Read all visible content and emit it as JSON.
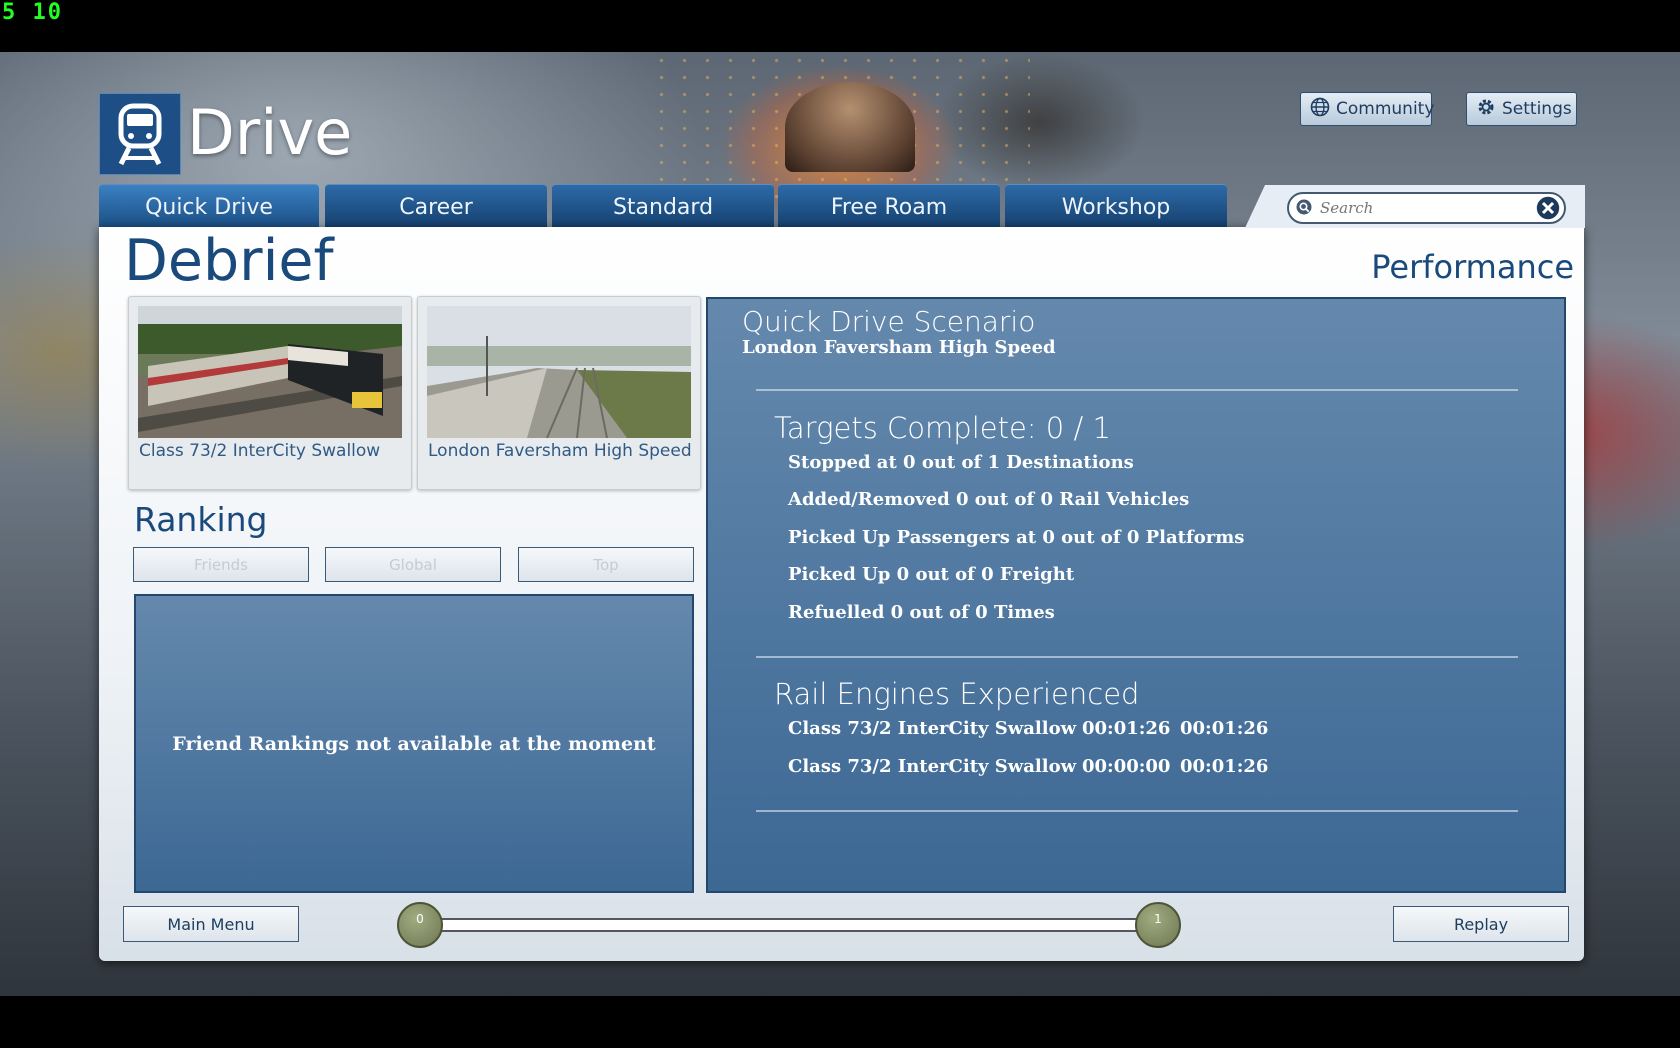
{
  "fps_counter": "5 10",
  "header": {
    "title": "Drive",
    "buttons": {
      "community": "Community",
      "settings": "Settings"
    }
  },
  "tabs": [
    {
      "label": "Quick Drive",
      "active": true
    },
    {
      "label": "Career",
      "active": false
    },
    {
      "label": "Standard",
      "active": false
    },
    {
      "label": "Free Roam",
      "active": false
    },
    {
      "label": "Workshop",
      "active": false
    }
  ],
  "search": {
    "placeholder": "Search"
  },
  "page": {
    "title": "Debrief",
    "section": "Performance"
  },
  "cards": [
    {
      "caption": "Class 73/2 InterCity Swallow",
      "icon": "locomotive-thumbnail"
    },
    {
      "caption": "London Faversham High Speed",
      "icon": "route-thumbnail"
    }
  ],
  "ranking": {
    "title": "Ranking",
    "buttons": [
      "Friends",
      "Global",
      "Top"
    ],
    "message": "Friend Rankings not available at the moment"
  },
  "performance": {
    "scenario_heading": "Quick Drive Scenario",
    "scenario_name": "London Faversham High Speed",
    "targets_heading": "Targets Complete: 0 / 1",
    "targets": [
      "Stopped at 0 out of 1 Destinations",
      "Added/Removed 0 out of 0 Rail Vehicles",
      "Picked Up Passengers at 0 out of 0 Platforms",
      "Picked Up 0 out of 0 Freight",
      "Refuelled 0 out of 0 Times"
    ],
    "engines_heading": "Rail Engines Experienced",
    "engines": [
      {
        "name": "Class 73/2 InterCity Swallow",
        "time1": "00:01:26",
        "time2": "00:01:26"
      },
      {
        "name": "Class 73/2 InterCity Swallow",
        "time1": "00:00:00",
        "time2": "00:01:26"
      }
    ]
  },
  "footer": {
    "main_menu": "Main Menu",
    "replay": "Replay",
    "slider_min": "0",
    "slider_max": "1"
  },
  "colors": {
    "accent": "#1a4a7c",
    "tab": "#1d4f86",
    "panel": "#4f77a0",
    "fps": "#22ff22"
  }
}
